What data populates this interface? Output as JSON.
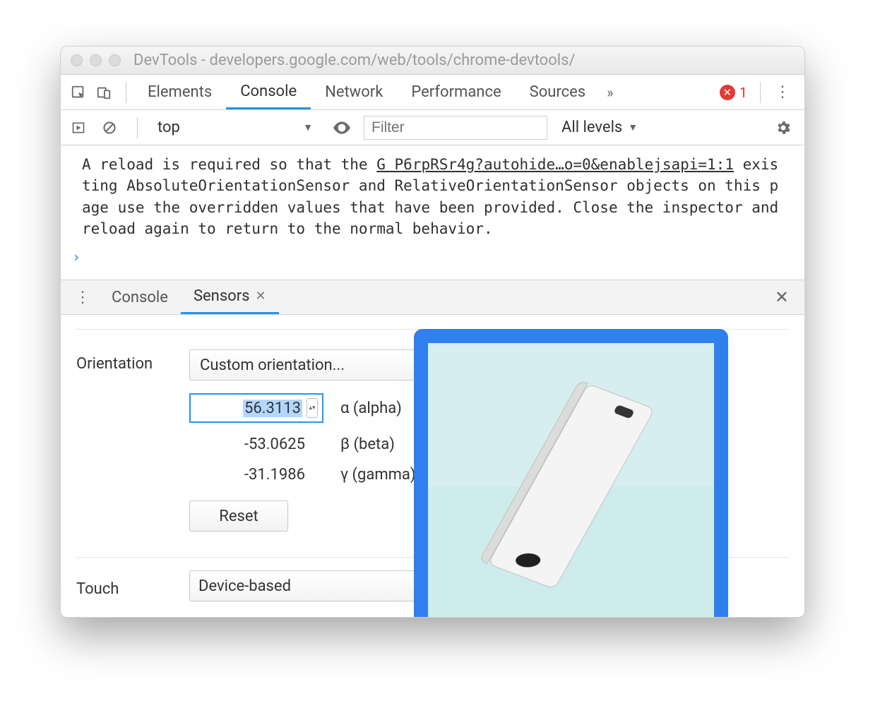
{
  "window": {
    "title": "DevTools - developers.google.com/web/tools/chrome-devtools/"
  },
  "maintabs": {
    "items": [
      "Elements",
      "Console",
      "Network",
      "Performance",
      "Sources"
    ],
    "active": "Console",
    "more_glyph": "»",
    "error_count": "1"
  },
  "console_toolbar": {
    "context": "top",
    "filter_placeholder": "Filter",
    "levels_label": "All levels"
  },
  "console_message": {
    "line1_prefix": "A reload is required so that the ",
    "source_link": "G P6rpRSr4g?autohide…o=0&enablejsapi=1:1",
    "rest": "existing AbsoluteOrientationSensor and RelativeOrientationSensor objects on this page use the overridden values that have been provided. Close the inspector and reload again to return to the normal behavior."
  },
  "prompt_glyph": "›",
  "drawer": {
    "tabs": [
      "Console",
      "Sensors"
    ],
    "active": "Sensors"
  },
  "sensors": {
    "orientation_label": "Orientation",
    "orientation_select": "Custom orientation...",
    "alpha_value": "56.3113",
    "alpha_label": "α (alpha)",
    "beta_value": "-53.0625",
    "beta_label": "β (beta)",
    "gamma_value": "-31.1986",
    "gamma_label": "γ (gamma)",
    "reset_label": "Reset",
    "touch_label": "Touch",
    "touch_select": "Device-based"
  }
}
